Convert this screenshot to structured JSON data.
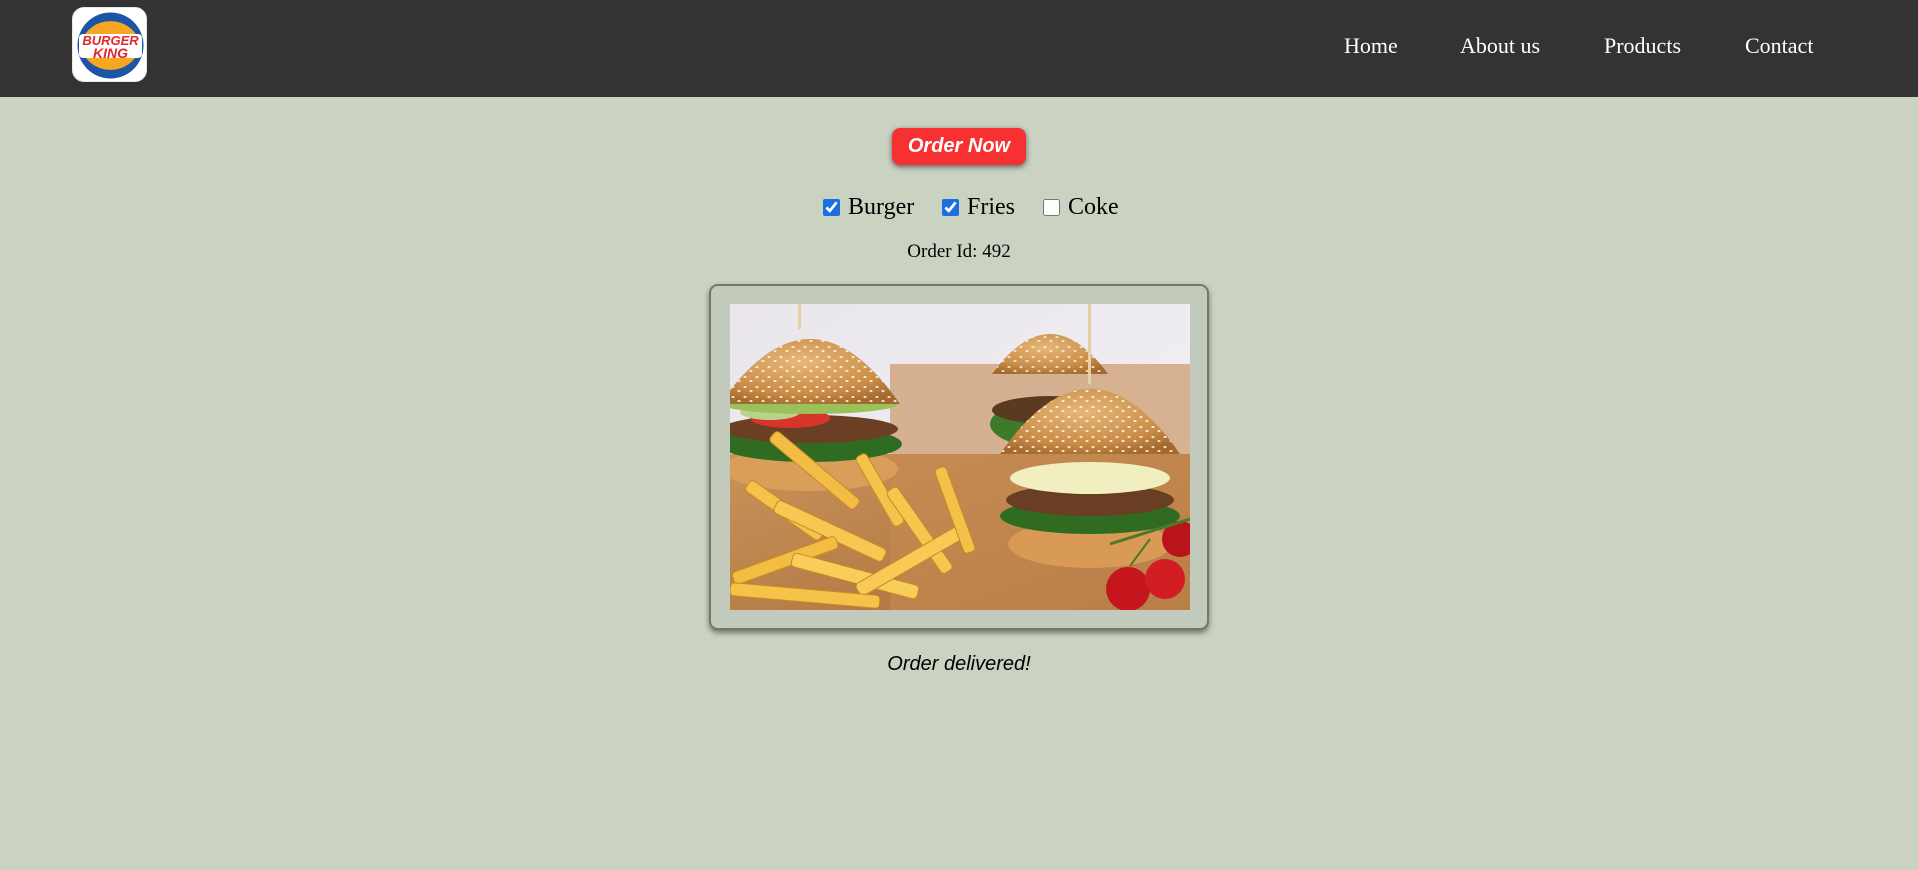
{
  "brand": {
    "logo_text_line1": "BURGER",
    "logo_text_line2": "KING"
  },
  "nav": {
    "items": [
      "Home",
      "About us",
      "Products",
      "Contact"
    ]
  },
  "order_button": {
    "label": "Order Now"
  },
  "options": [
    {
      "label": "Burger",
      "checked": true
    },
    {
      "label": "Fries",
      "checked": true
    },
    {
      "label": "Coke",
      "checked": false
    }
  ],
  "order": {
    "id_text": "Order Id: 492",
    "status_text": "Order delivered!"
  },
  "image": {
    "subject": "burgers-and-fries-photo"
  },
  "colors": {
    "navbar": "#333333",
    "background": "#cad3c2",
    "button": "#f73131",
    "nav_text": "#ffffff",
    "checkbox": "#1b6fe0"
  }
}
